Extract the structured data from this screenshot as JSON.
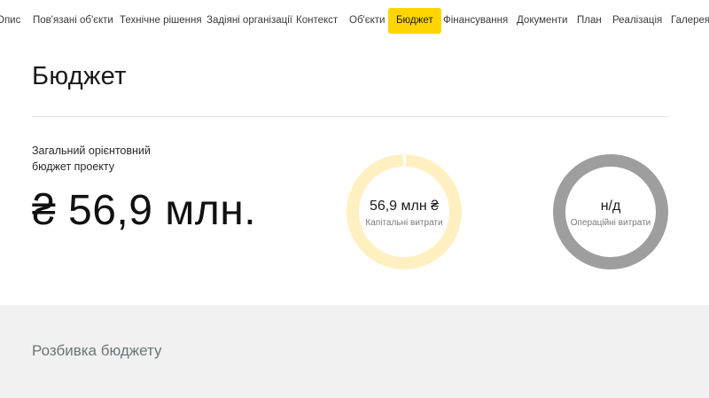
{
  "nav": {
    "items": [
      {
        "label": "Опис",
        "active": false
      },
      {
        "label": "Пов'язані об'єкти",
        "active": false
      },
      {
        "label": "Технічне рішення",
        "active": false
      },
      {
        "label": "Задіяні організації",
        "active": false
      },
      {
        "label": "Контекст",
        "active": false
      },
      {
        "label": "Об'єкти",
        "active": false
      },
      {
        "label": "Бюджет",
        "active": true
      },
      {
        "label": "Фінансування",
        "active": false
      },
      {
        "label": "Документи",
        "active": false
      },
      {
        "label": "План",
        "active": false
      },
      {
        "label": "Реалізація",
        "active": false
      },
      {
        "label": "Галерея",
        "active": false
      }
    ]
  },
  "page": {
    "title": "Бюджет"
  },
  "budget": {
    "label": "Загальний орієнтовний бюджет проекту",
    "total": "₴ 56,9 млн."
  },
  "rings": {
    "capital": {
      "value": "56,9 млн ₴",
      "caption": "Капітальні витрати",
      "color": "#fff0c2",
      "fill_fraction": 0.99
    },
    "operational": {
      "value": "н/д",
      "caption": "Операційні витрати",
      "color": "#9e9e9e",
      "fill_fraction": 1.0
    }
  },
  "breakdown": {
    "title": "Розбивка бюджету",
    "background": "#f1f1f1"
  },
  "colors": {
    "accent": "#ffd500"
  }
}
